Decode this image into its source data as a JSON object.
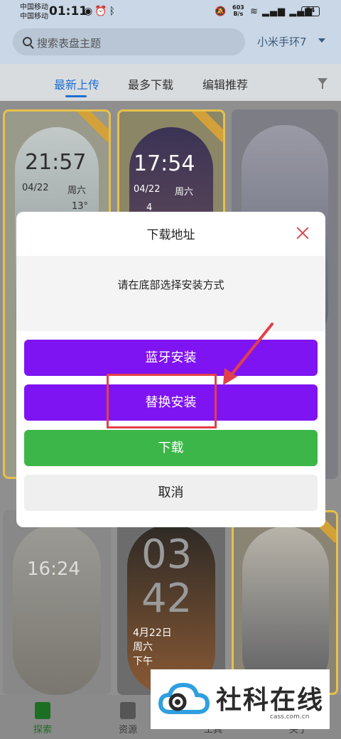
{
  "status_bar": {
    "carrier1": "中国移动",
    "carrier2": "中国移动",
    "time": "01:11",
    "net_speed_value": "603",
    "net_speed_unit": "B/s",
    "battery": "74"
  },
  "header": {
    "search_placeholder": "搜索表盘主题",
    "device": "小米手环7"
  },
  "tabs": [
    {
      "label": "最新上传",
      "active": true
    },
    {
      "label": "最多下载",
      "active": false
    },
    {
      "label": "编辑推荐",
      "active": false
    }
  ],
  "background_cards": {
    "card1": {
      "time": "21:57",
      "date": "04/22",
      "weekday": "周六",
      "temp": "13°"
    },
    "card2": {
      "time": "17:54",
      "date": "04/22",
      "weekday": "周六",
      "temp": "4"
    },
    "card4": {
      "top": "16:24"
    },
    "card5": {
      "hour": "03",
      "minute": "42",
      "date": "4月22日",
      "weekday": "周六",
      "extra": "下午"
    }
  },
  "dialog": {
    "title": "下载地址",
    "message": "请在底部选择安装方式",
    "buttons": {
      "bluetooth": "蓝牙安装",
      "replace": "替换安装",
      "download": "下载",
      "cancel": "取消"
    }
  },
  "bottom_nav": [
    {
      "label": "探索",
      "active": true
    },
    {
      "label": "资源",
      "active": false
    },
    {
      "label": "工具",
      "active": false
    },
    {
      "label": "关于",
      "active": false
    }
  ],
  "watermark": {
    "title": "社科在线",
    "url": "cass.com.cn"
  },
  "colors": {
    "accent_purple": "#7f14f2",
    "download_green": "#3db649",
    "tab_active_blue": "#1f6fd0",
    "annotation_red": "#e2404b"
  }
}
